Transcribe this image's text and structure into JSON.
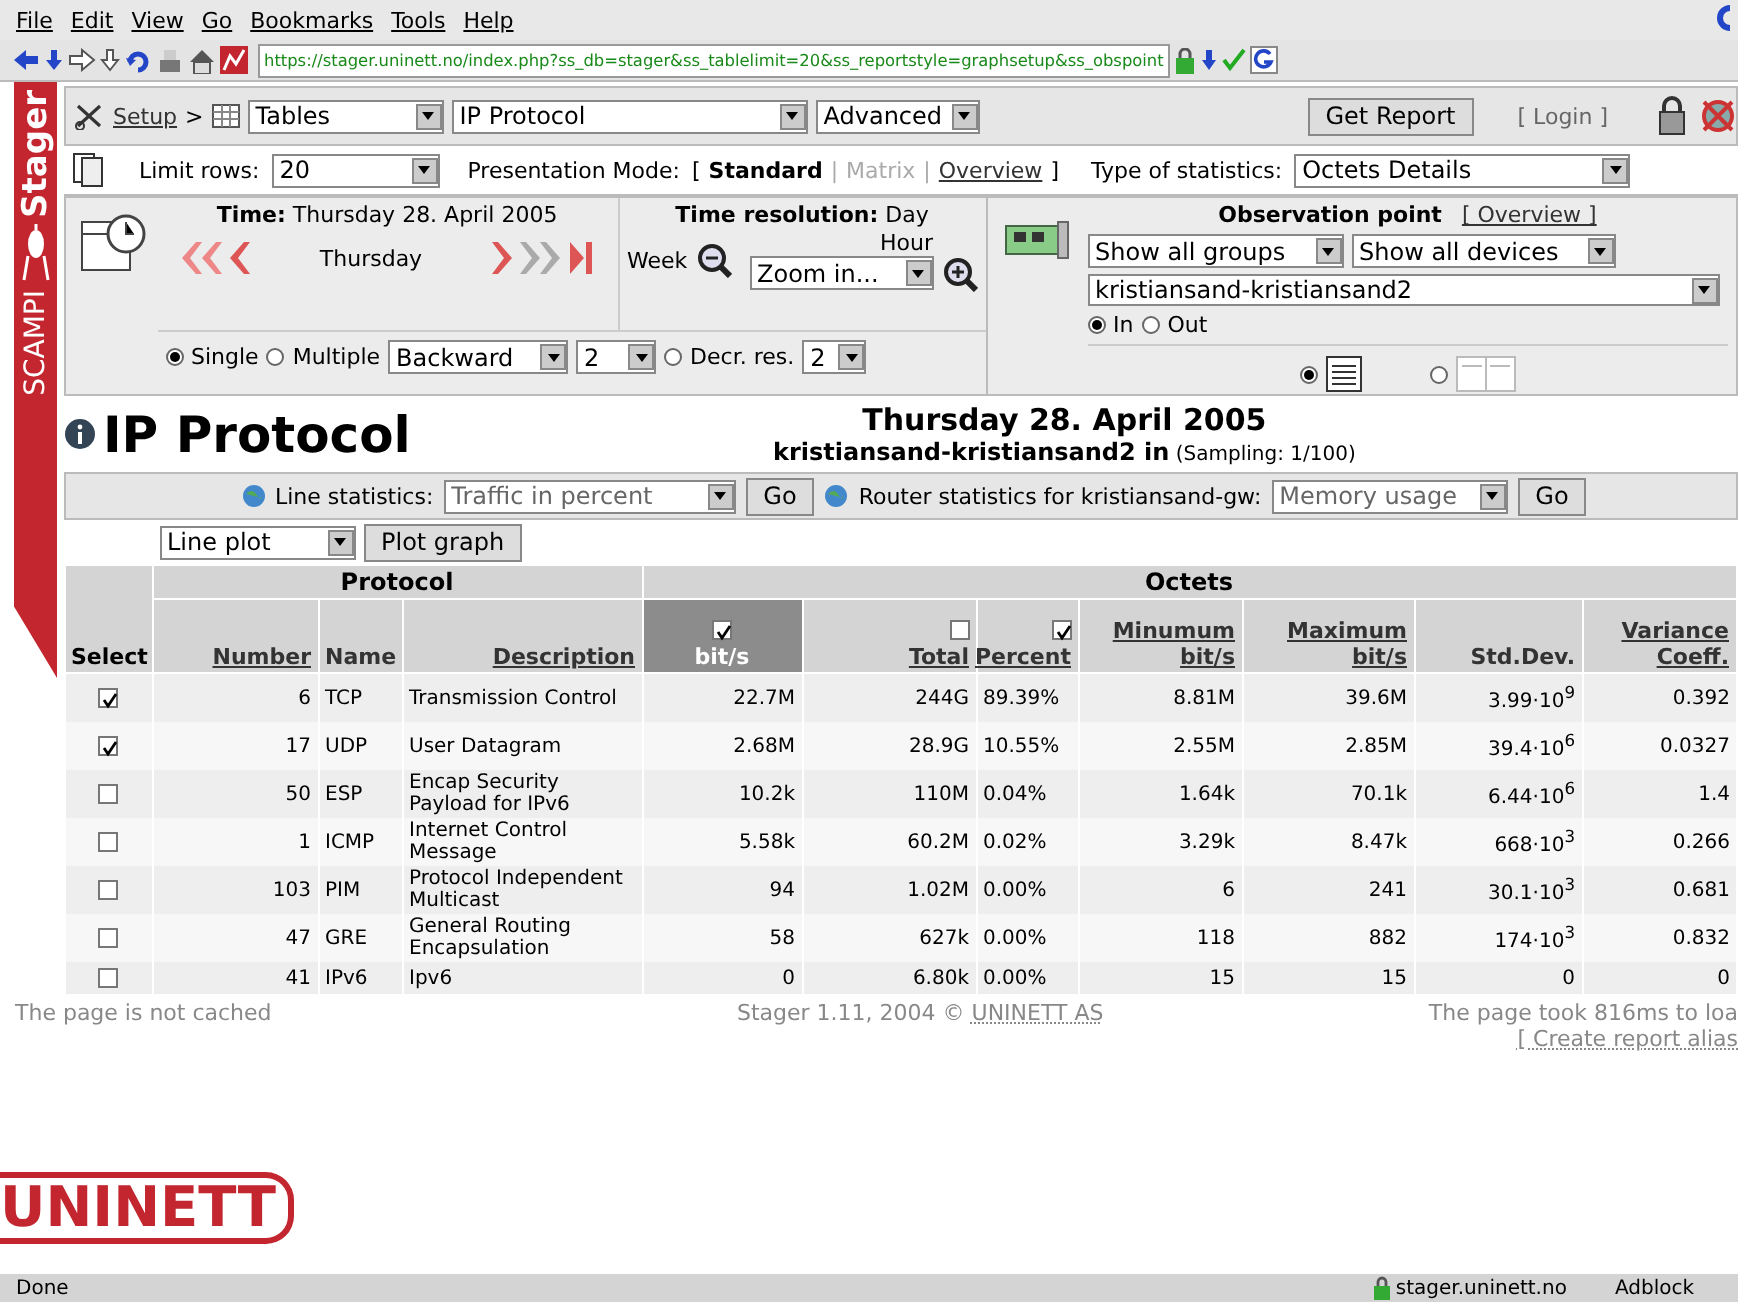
{
  "menu": [
    "File",
    "Edit",
    "View",
    "Go",
    "Bookmarks",
    "Tools",
    "Help"
  ],
  "address": {
    "url": "https://stager.uninett.no/index.php?ss_db=stager&ss_tablelimit=20&ss_reportstyle=graphsetup&ss_obspoint"
  },
  "sidebar": {
    "top": "Stager",
    "bottom": "SCAMPI"
  },
  "setup": {
    "link": "Setup",
    "separator": ">",
    "section": "Tables",
    "report": "IP Protocol",
    "mode": "Advanced",
    "get_report": "Get Report",
    "login": "[ Login ]"
  },
  "options": {
    "limit_label": "Limit rows:",
    "limit": "20",
    "presentation_label": "Presentation Mode:",
    "open": "[",
    "close": "]",
    "separator": "|",
    "presentation_modes": [
      {
        "label": "Standard",
        "selected": true,
        "disabled": false
      },
      {
        "label": "Matrix",
        "selected": false,
        "disabled": true
      },
      {
        "label": "Overview",
        "selected": false,
        "disabled": false
      }
    ],
    "stats_label": "Type of statistics:",
    "stats": "Octets Details"
  },
  "time": {
    "time": "**Time:** Thursday 28. April 2005",
    "day": "Thursday",
    "resolution": "**Time resolution:** Day",
    "week": "Week",
    "hour": "Hour",
    "zoom": "Zoom in...",
    "modes": [
      {
        "label": "Single",
        "selected": true
      },
      {
        "label": "Multiple",
        "selected": false
      }
    ],
    "direction": "Backward",
    "count": "2",
    "decrease": {
      "label": "Decr. res.",
      "selected": false,
      "value": "2"
    }
  },
  "observation": {
    "title": "Observation point",
    "overview": "[ Overview ]",
    "groups": "Show all groups",
    "devices": "Show all devices",
    "device": "kristiansand-kristiansand2",
    "directions": [
      {
        "label": "In",
        "selected": true
      },
      {
        "label": "Out",
        "selected": false
      }
    ],
    "views": [
      {
        "kind": "table",
        "selected": true
      },
      {
        "kind": "columns",
        "selected": false
      }
    ]
  },
  "header": {
    "title": "IP Protocol",
    "date": "Thursday 28. April 2005",
    "device": "kristiansand-kristiansand2 in",
    "sampling": "(Sampling: 1/100)"
  },
  "statistics": {
    "line_label": "Line statistics:",
    "line_select": "Traffic in percent",
    "line_go": "Go",
    "router_label": "Router statistics for kristiansand-gw:",
    "router_select": "Memory usage",
    "router_go": "Go"
  },
  "plot": {
    "type": "Line plot",
    "button": "Plot graph"
  },
  "table": {
    "groups": [
      "Protocol",
      "Octets"
    ],
    "select_header": "Select",
    "columns": [
      {
        "label": "Number",
        "link": true,
        "sorted": false
      },
      {
        "label": "Name",
        "link": false,
        "sorted": false
      },
      {
        "label": "Description",
        "link": true,
        "sorted": false
      },
      {
        "label": "bit/s",
        "link": false,
        "checked": true,
        "sorted": true
      },
      {
        "label": "Total",
        "link": true,
        "checked": false,
        "sorted": false
      },
      {
        "label": "Percent",
        "link": true,
        "checked": true,
        "sorted": false
      },
      {
        "label": "Minumum\nbit/s",
        "link": true,
        "sorted": false
      },
      {
        "label": "Maximum\nbit/s",
        "link": true,
        "sorted": false
      },
      {
        "label": "Std.Dev.",
        "link": false,
        "sorted": false
      },
      {
        "label": "Variance\nCoeff.",
        "link": true,
        "sorted": false
      }
    ],
    "rows": [
      {
        "selected": true,
        "cells": [
          "6",
          "TCP",
          "Transmission Control",
          "22.7M",
          "244G",
          "89.39%",
          "8.81M",
          "39.6M",
          "3.99·10$^{9}$",
          "0.392"
        ]
      },
      {
        "selected": true,
        "cells": [
          "17",
          "UDP",
          "User Datagram",
          "2.68M",
          "28.9G",
          "10.55%",
          "2.55M",
          "2.85M",
          "39.4·10$^{6}$",
          "0.0327"
        ]
      },
      {
        "selected": false,
        "cells": [
          "50",
          "ESP",
          "Encap Security Payload for IPv6",
          "10.2k",
          "110M",
          "0.04%",
          "1.64k",
          "70.1k",
          "6.44·10$^{6}$",
          "1.4"
        ]
      },
      {
        "selected": false,
        "cells": [
          "1",
          "ICMP",
          "Internet Control Message",
          "5.58k",
          "60.2M",
          "0.02%",
          "3.29k",
          "8.47k",
          "668·10$^{3}$",
          "0.266"
        ]
      },
      {
        "selected": false,
        "cells": [
          "103",
          "PIM",
          "Protocol Independent Multicast",
          "94",
          "1.02M",
          "0.00%",
          "6",
          "241",
          "30.1·10$^{3}$",
          "0.681"
        ]
      },
      {
        "selected": false,
        "cells": [
          "47",
          "GRE",
          "General Routing Encapsulation",
          "58",
          "627k",
          "0.00%",
          "118",
          "882",
          "174·10$^{3}$",
          "0.832"
        ]
      },
      {
        "selected": false,
        "cells": [
          "41",
          "IPv6",
          "Ipv6",
          "0",
          "6.80k",
          "0.00%",
          "15",
          "15",
          "0",
          "0"
        ]
      }
    ]
  },
  "footer": {
    "cache": "The page is not cached",
    "credit": "Stager 1.11, 2004 © ",
    "credit_link": "UNINETT AS",
    "timing": "The page took 816ms to loa",
    "alias": "[ Create report alias"
  },
  "logo": "UNINETT",
  "status": {
    "text": "Done",
    "host": "stager.uninett.no",
    "adblock": "Adblock"
  }
}
